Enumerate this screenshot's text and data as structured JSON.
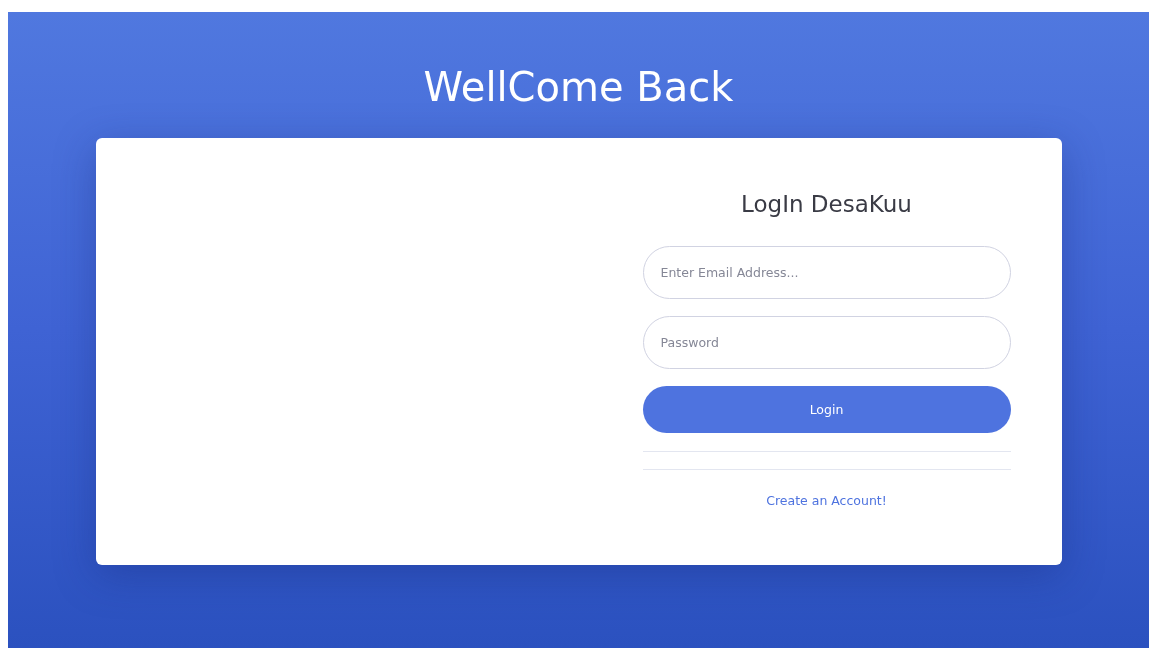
{
  "page_title": "WellCome Back",
  "login_form": {
    "heading": "LogIn DesaKuu",
    "fields": [
      {
        "placeholder": "Enter Email Address..."
      },
      {
        "placeholder": "Password"
      }
    ],
    "button": "Login",
    "link": "Create an Account!"
  }
}
